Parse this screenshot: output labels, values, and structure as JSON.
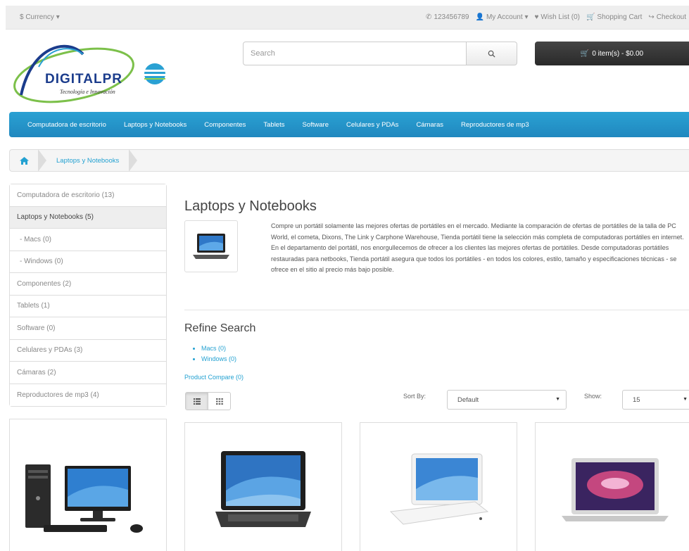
{
  "topbar": {
    "currency": "$ Currency",
    "phone": "123456789",
    "my_account": "My Account",
    "wishlist": "Wish List (0)",
    "cart": "Shopping Cart",
    "checkout": "Checkout"
  },
  "logo": {
    "text": "DIGITALPR",
    "tagline": "Tecnología e Innovación"
  },
  "search": {
    "placeholder": "Search"
  },
  "cart_button": {
    "label": "0 item(s) - $0.00"
  },
  "nav": {
    "items": [
      "Computadora de escritorio",
      "Laptops y Notebooks",
      "Componentes",
      "Tablets",
      "Software",
      "Celulares y PDAs",
      "Cámaras",
      "Reproductores de mp3"
    ]
  },
  "breadcrumb": {
    "current": "Laptops y Notebooks"
  },
  "sidebar": {
    "items": [
      "Computadora de escritorio (13)",
      "Laptops y Notebooks (5)",
      "- Macs (0)",
      "- Windows (0)",
      "Componentes (2)",
      "Tablets (1)",
      "Software (0)",
      "Celulares y PDAs (3)",
      "Cámaras (2)",
      "Reproductores de mp3 (4)"
    ]
  },
  "category": {
    "title": "Laptops y Notebooks",
    "description": "Compre un portátil solamente las mejores ofertas de portátiles en el mercado. Mediante la comparación de ofertas de portátiles de la talla de PC World, el cometa, Dixons, The Link y Carphone Warehouse, Tienda portátil tiene la selección más completa de computadoras portátiles en internet. En el departamento del portátil, nos enorgullecemos de ofrecer a los clientes las mejores ofertas de portátiles. Desde computadoras portátiles restauradas para netbooks, Tienda portátil asegura que todos los portátiles - en todos los colores, estilo, tamaño y especificaciones técnicas - se ofrece en el sitio al precio más bajo posible."
  },
  "refine": {
    "title": "Refine Search",
    "items": [
      "Macs (0)",
      "Windows (0)"
    ]
  },
  "compare": {
    "label": "Product Compare (0)"
  },
  "sort": {
    "label": "Sort By:",
    "value": "Default"
  },
  "show": {
    "label": "Show:",
    "value": "15"
  },
  "colors": {
    "accent": "#23a1d1",
    "nav": "#2497cb",
    "cart": "#333333"
  }
}
